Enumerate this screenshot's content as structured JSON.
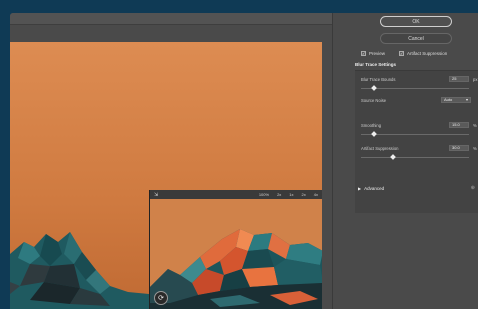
{
  "buttons": {
    "ok": "OK",
    "cancel": "Cancel"
  },
  "checkboxes": {
    "preview": {
      "label": "Preview",
      "checked": true
    },
    "artifact": {
      "label": "Artifact Suppression",
      "checked": true
    }
  },
  "settings": {
    "title": "Blur Trace Settings",
    "blur_trace_bounds": {
      "label": "Blur Trace Bounds",
      "value": "25",
      "unit": "px",
      "level": 0.12
    },
    "source_noise": {
      "label": "Source Noise",
      "value": "Auto"
    },
    "smoothing": {
      "label": "Smoothing",
      "value": "15.0",
      "unit": "%",
      "level": 0.12
    },
    "artifact_suppression": {
      "label": "Artifact Suppression",
      "value": "30.0",
      "unit": "%",
      "level": 0.3
    }
  },
  "advanced": {
    "label": "Advanced"
  },
  "detail": {
    "zoom_levels": [
      "100%",
      "2x",
      "1x",
      "2x",
      "4x"
    ]
  },
  "colors": {
    "sky": "#d9854a",
    "mountain_rock": "#1f5c63",
    "mountain_highlight": "#e06b3c",
    "background": "#0f3a55"
  }
}
